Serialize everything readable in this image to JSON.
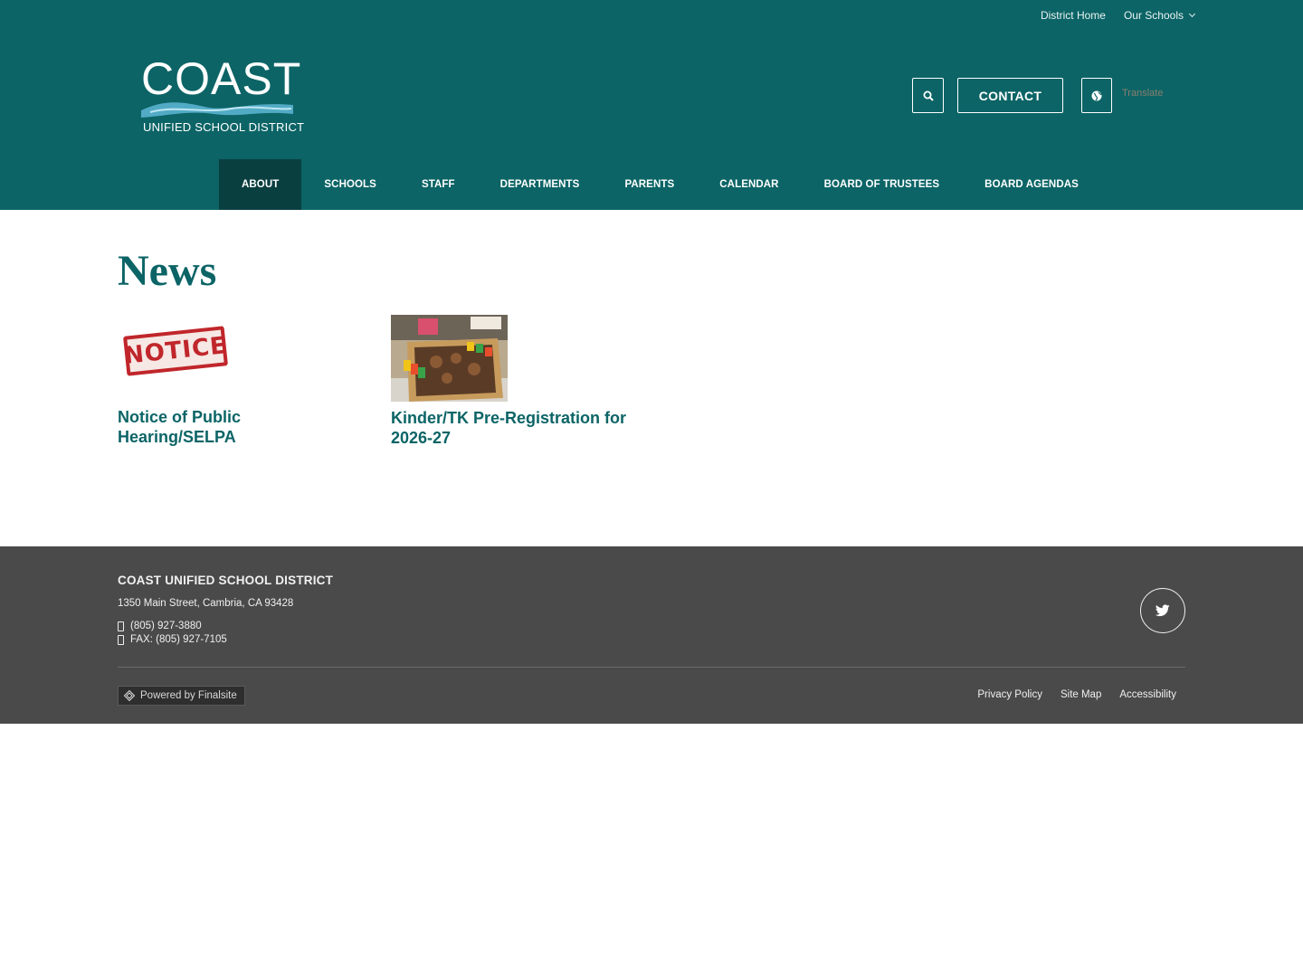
{
  "utility_nav": {
    "district_home": "District Home",
    "our_schools": "Our Schools"
  },
  "logo": {
    "word": "COAST",
    "subtitle": "UNIFIED SCHOOL DISTRICT"
  },
  "header_actions": {
    "contact_label": "CONTACT",
    "search_icon": "search-icon",
    "globe_icon": "globe-icon",
    "translate_label": "Translate"
  },
  "main_nav": {
    "items": [
      {
        "label": "ABOUT",
        "active": true
      },
      {
        "label": "SCHOOLS"
      },
      {
        "label": "STAFF"
      },
      {
        "label": "DEPARTMENTS"
      },
      {
        "label": "PARENTS"
      },
      {
        "label": "CALENDAR"
      },
      {
        "label": "BOARD OF TRUSTEES"
      },
      {
        "label": "BOARD AGENDAS"
      }
    ]
  },
  "page": {
    "title": "News"
  },
  "news": [
    {
      "headline": "Notice of Public Hearing/SELPA",
      "image_text": "NOTICE"
    },
    {
      "headline": "Kinder/TK Pre-Registration for 2026-27"
    }
  ],
  "footer": {
    "district_name": "COAST UNIFIED SCHOOL DISTRICT",
    "address": "1350 Main Street, Cambria, CA 93428",
    "phone": "(805) 927-3880",
    "fax": "FAX: (805) 927-7105",
    "social_icon": "twitter-icon",
    "powered_by": "Powered by Finalsite",
    "links": [
      "Privacy Policy",
      "Site Map",
      "Accessibility"
    ]
  },
  "colors": {
    "brand_teal": "#0c6466",
    "nav_active": "#0a3f40",
    "footer_bg": "#4a4a4a",
    "notice_red": "#c0262b"
  }
}
